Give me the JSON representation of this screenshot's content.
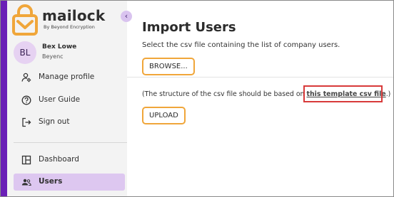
{
  "brand": {
    "name": "mailock",
    "tagline": "By Beyond Encryption",
    "logo_color": "#f0a63a"
  },
  "colors": {
    "accent_bar": "#6a1fb6",
    "active_nav": "#ddc7f0",
    "button_border": "#f0a63a",
    "highlight": "#d83a3a"
  },
  "collapse_icon": "chevron-left-icon",
  "user": {
    "initials": "BL",
    "name": "Bex Lowe",
    "org": "Beyenc"
  },
  "nav": {
    "manage_profile": {
      "label": "Manage profile",
      "icon": "user-gear-icon"
    },
    "user_guide": {
      "label": "User Guide",
      "icon": "help-circle-icon"
    },
    "sign_out": {
      "label": "Sign out",
      "icon": "sign-out-icon"
    },
    "dashboard": {
      "label": "Dashboard",
      "icon": "dashboard-icon"
    },
    "users": {
      "label": "Users",
      "icon": "users-icon",
      "active": true
    }
  },
  "main": {
    "title": "Import Users",
    "subtitle": "Select the csv file containing the list of company users.",
    "browse_label": "BROWSE...",
    "note_prefix": "(The structure of the csv file should be based on ",
    "note_link": "this template csv file",
    "note_suffix": ".)",
    "upload_label": "UPLOAD"
  }
}
